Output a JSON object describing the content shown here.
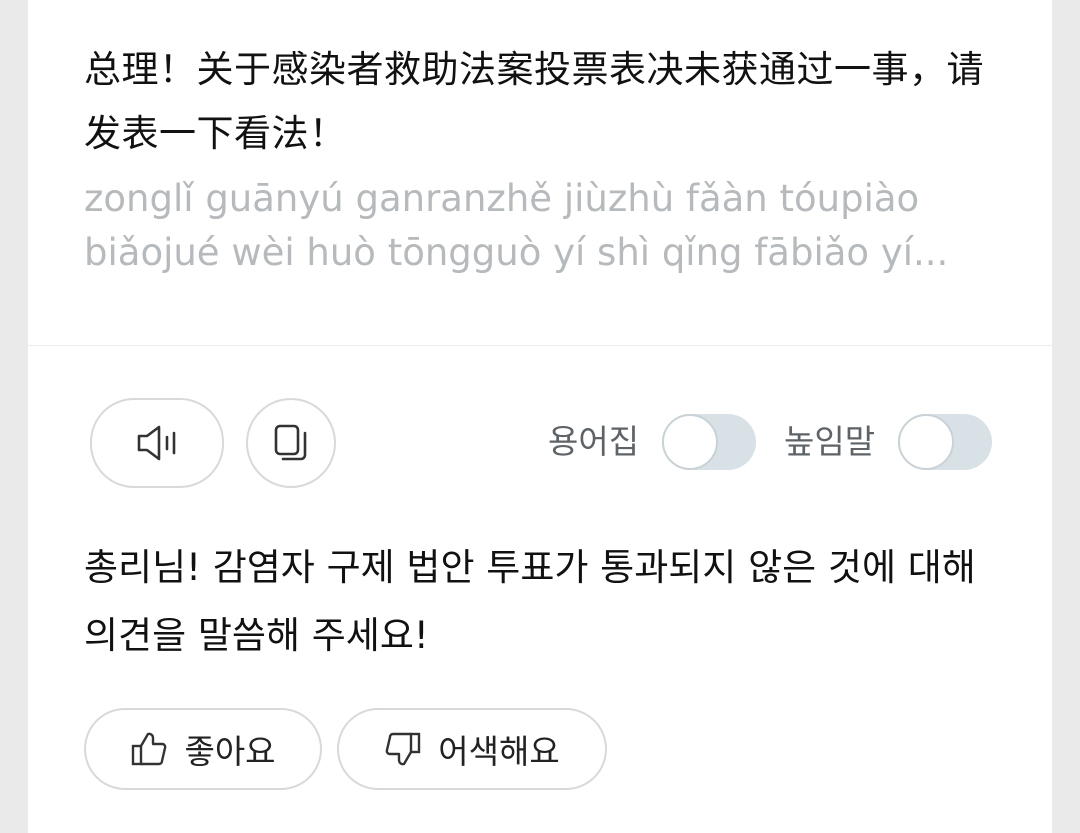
{
  "source": {
    "text": "总理！关于感染者救助法案投票表决未获通过一事，请发表一下看法！",
    "pinyin": "zonglǐ guānyú ganranzhě jiùzhù fǎàn tóupiào biǎojué wèi huò tōngguò yí shì qǐng fābiǎo yí..."
  },
  "controls": {
    "speaker_icon": "speaker-icon",
    "copy_icon": "copy-icon",
    "glossary_label": "용어집",
    "glossary_on": false,
    "honorific_label": "높임말",
    "honorific_on": false
  },
  "result": {
    "text": "총리님! 감염자 구제 법안 투표가 통과되지 않은 것에 대해 의견을 말씀해 주세요!"
  },
  "feedback": {
    "like_label": "좋아요",
    "dislike_label": "어색해요"
  },
  "colors": {
    "toggle_off_track": "#d7e1e6",
    "pinyin_text": "#b6babd"
  }
}
